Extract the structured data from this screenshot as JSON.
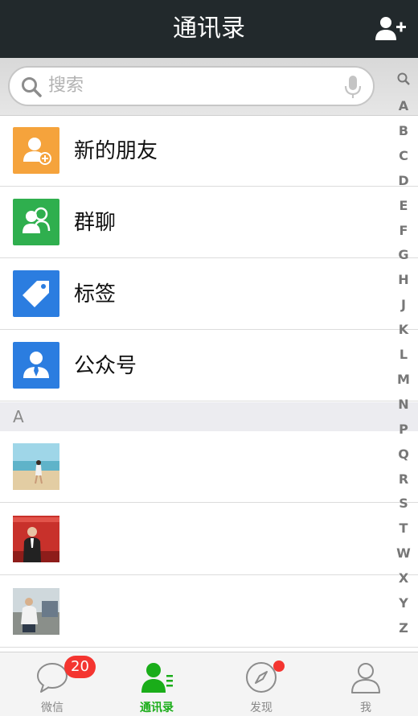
{
  "header": {
    "title": "通讯录",
    "add_contact_icon": "add-contact-icon"
  },
  "search": {
    "placeholder": "搜索",
    "icon": "search-icon",
    "mic_icon": "microphone-icon"
  },
  "functions": [
    {
      "label": "新的朋友",
      "icon": "new-friend-icon",
      "color": "#f5a33c"
    },
    {
      "label": "群聊",
      "icon": "group-chat-icon",
      "color": "#2faf4e"
    },
    {
      "label": "标签",
      "icon": "tag-icon",
      "color": "#2b7de0"
    },
    {
      "label": "公众号",
      "icon": "official-account-icon",
      "color": "#2b7de0"
    }
  ],
  "section": {
    "label": "A"
  },
  "contacts": [
    {
      "avatar": "photo-beach-avatar"
    },
    {
      "avatar": "photo-banner-avatar"
    },
    {
      "avatar": "photo-outdoor-avatar"
    }
  ],
  "index": [
    "search-icon",
    "A",
    "B",
    "C",
    "D",
    "E",
    "F",
    "G",
    "H",
    "J",
    "K",
    "L",
    "M",
    "N",
    "P",
    "Q",
    "R",
    "S",
    "T",
    "W",
    "X",
    "Y",
    "Z"
  ],
  "tabbar": {
    "tabs": [
      {
        "label": "微信",
        "icon": "chat-bubble-icon",
        "badge": "20",
        "active": false
      },
      {
        "label": "通讯录",
        "icon": "contacts-icon",
        "active": true
      },
      {
        "label": "发现",
        "icon": "compass-icon",
        "dot": true,
        "active": false
      },
      {
        "label": "我",
        "icon": "person-icon",
        "active": false
      }
    ]
  },
  "colors": {
    "header_bg": "#22292c",
    "accent": "#1aad19",
    "badge": "#f43530"
  }
}
